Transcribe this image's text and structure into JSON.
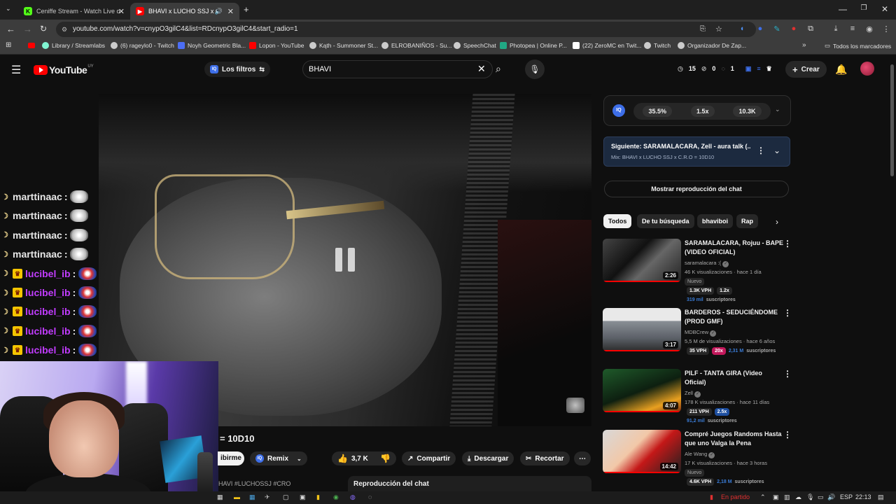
{
  "browser": {
    "tabs": [
      {
        "title": "Ceniffe Stream - Watch Live on",
        "active": false
      },
      {
        "title": "BHAVI x LUCHO SSJ x C.R.O",
        "active": true
      }
    ],
    "url": "youtube.com/watch?v=cnypO3gilC4&list=RDcnypO3gilC4&start_radio=1",
    "bookmarks": [
      "Library / Streamlabs",
      "(6) rageylo0 - Twitch",
      "Noyh Geometric Bla...",
      "Lopon - YouTube",
      "Kąth - Summoner St...",
      "ELROBANIÑOS - Su...",
      "SpeechChat",
      "Photopea | Online P...",
      "(22) ZeroMC en Twit...",
      "Twitch",
      "Organizador De Zap..."
    ],
    "bookmarks_all": "Todos los marcadores"
  },
  "youtube": {
    "logo_text": "YouTube",
    "region": "UY",
    "filters_label": "Los filtros",
    "search_value": "BHAVI",
    "counters": [
      "15",
      "0",
      "1"
    ],
    "create_label": "Crear"
  },
  "chat_overlay": [
    {
      "user": "marttinaac",
      "sep": ":",
      "color": "#e8e8e8",
      "badge": false
    },
    {
      "user": "marttinaac",
      "sep": ":",
      "color": "#e8e8e8",
      "badge": false
    },
    {
      "user": "marttinaac",
      "sep": ":",
      "color": "#e8e8e8",
      "badge": false
    },
    {
      "user": "marttinaac",
      "sep": ":",
      "color": "#e8e8e8",
      "badge": false
    },
    {
      "user": "lucibel_ib",
      "sep": ":",
      "color": "#c23cff",
      "badge": true
    },
    {
      "user": "lucibel_ib",
      "sep": ":",
      "color": "#c23cff",
      "badge": true
    },
    {
      "user": "lucibel_ib",
      "sep": ":",
      "color": "#c23cff",
      "badge": true
    },
    {
      "user": "lucibel_ib",
      "sep": ":",
      "color": "#c23cff",
      "badge": true
    },
    {
      "user": "lucibel_ib",
      "sep": ":",
      "color": "#c23cff",
      "badge": true
    }
  ],
  "video": {
    "title_fragment": "= 10D10",
    "subscribe_fragment": "ibirme",
    "remix_label": "Remix",
    "likes": "3,7 K",
    "share_label": "Compartir",
    "download_label": "Descargar",
    "clip_label": "Recortar",
    "hashtags_fragment": "HAVI #LUCHOSSJ #CRO",
    "chat_replay_label": "Reproducción del chat"
  },
  "extension": {
    "stats": [
      "35.5%",
      "1.5x",
      "10.3K"
    ]
  },
  "next_up": {
    "title": "Siguiente: SARAMALACARA, Zell - aura talk (...",
    "subtitle": "Mix: BHAVI x LUCHO SSJ x C.R.O = 10D10"
  },
  "show_chat_label": "Mostrar reproducción del chat",
  "chips": [
    "Todos",
    "De tu búsqueda",
    "bhaviboi",
    "Rap"
  ],
  "recommendations": [
    {
      "title": "SARAMALACARA, Rojuu - BAPE (VIDEO OFICIAL)",
      "channel": "saramalacara :(",
      "meta": "46 K visualizaciones · hace 1 día",
      "duration": "2:26",
      "badge": "Nuevo",
      "vph": "1.3K VPH",
      "mult": "1.2x",
      "mult_style": "",
      "subs": "319 mil",
      "subs_label": "suscriptores",
      "thumb": "linear-gradient(135deg,#444,#111 40%,#666 60%,#222)"
    },
    {
      "title": "BARDEROS - SEDUCIÉNDOME (PROD GMF)",
      "channel": "MDBCrew",
      "meta": "5,5 M de visualizaciones · hace 6 años",
      "duration": "3:17",
      "badge": "",
      "vph": "35 VPH",
      "mult": "20x",
      "mult_style": "pink",
      "subs": "2,31 M",
      "subs_label": "suscriptores",
      "thumb": "linear-gradient(180deg,#e9e9e9 0 30%,#8a8f96 30%,#5a5f66 70%,#2a2a2a)"
    },
    {
      "title": "PILF - TANTA GIRA (Video Oficial)",
      "channel": "Zell",
      "meta": "178 K visualizaciones · hace 11 días",
      "duration": "4:07",
      "badge": "",
      "vph": "211 VPH",
      "mult": "2.5x",
      "mult_style": "blue",
      "subs": "91,2 mil",
      "subs_label": "suscriptores",
      "thumb": "linear-gradient(160deg,#1f5a2a,#0d1f10 50%,#e8a020 80%,#7a2a10)"
    },
    {
      "title": "Compré Juegos Randoms Hasta que uno Valga la Pena",
      "channel": "Ale Wang",
      "meta": "17 K visualizaciones · hace 3 horas",
      "duration": "14:42",
      "badge": "Nuevo",
      "vph": "4.6K VPH",
      "mult": "",
      "mult_style": "",
      "subs": "2,18 M",
      "subs_label": "suscriptores",
      "thumb": "linear-gradient(135deg,#d8d8d8,#f2c8a8 40%,#c41818 60%,#202020)"
    }
  ],
  "taskbar": {
    "status": "En partido",
    "lang": "ESP",
    "time": "22:13"
  },
  "colors": {
    "yt_red": "#ff0000",
    "bg": "#0f0f0f",
    "accent_blue": "#3d6ee8"
  }
}
